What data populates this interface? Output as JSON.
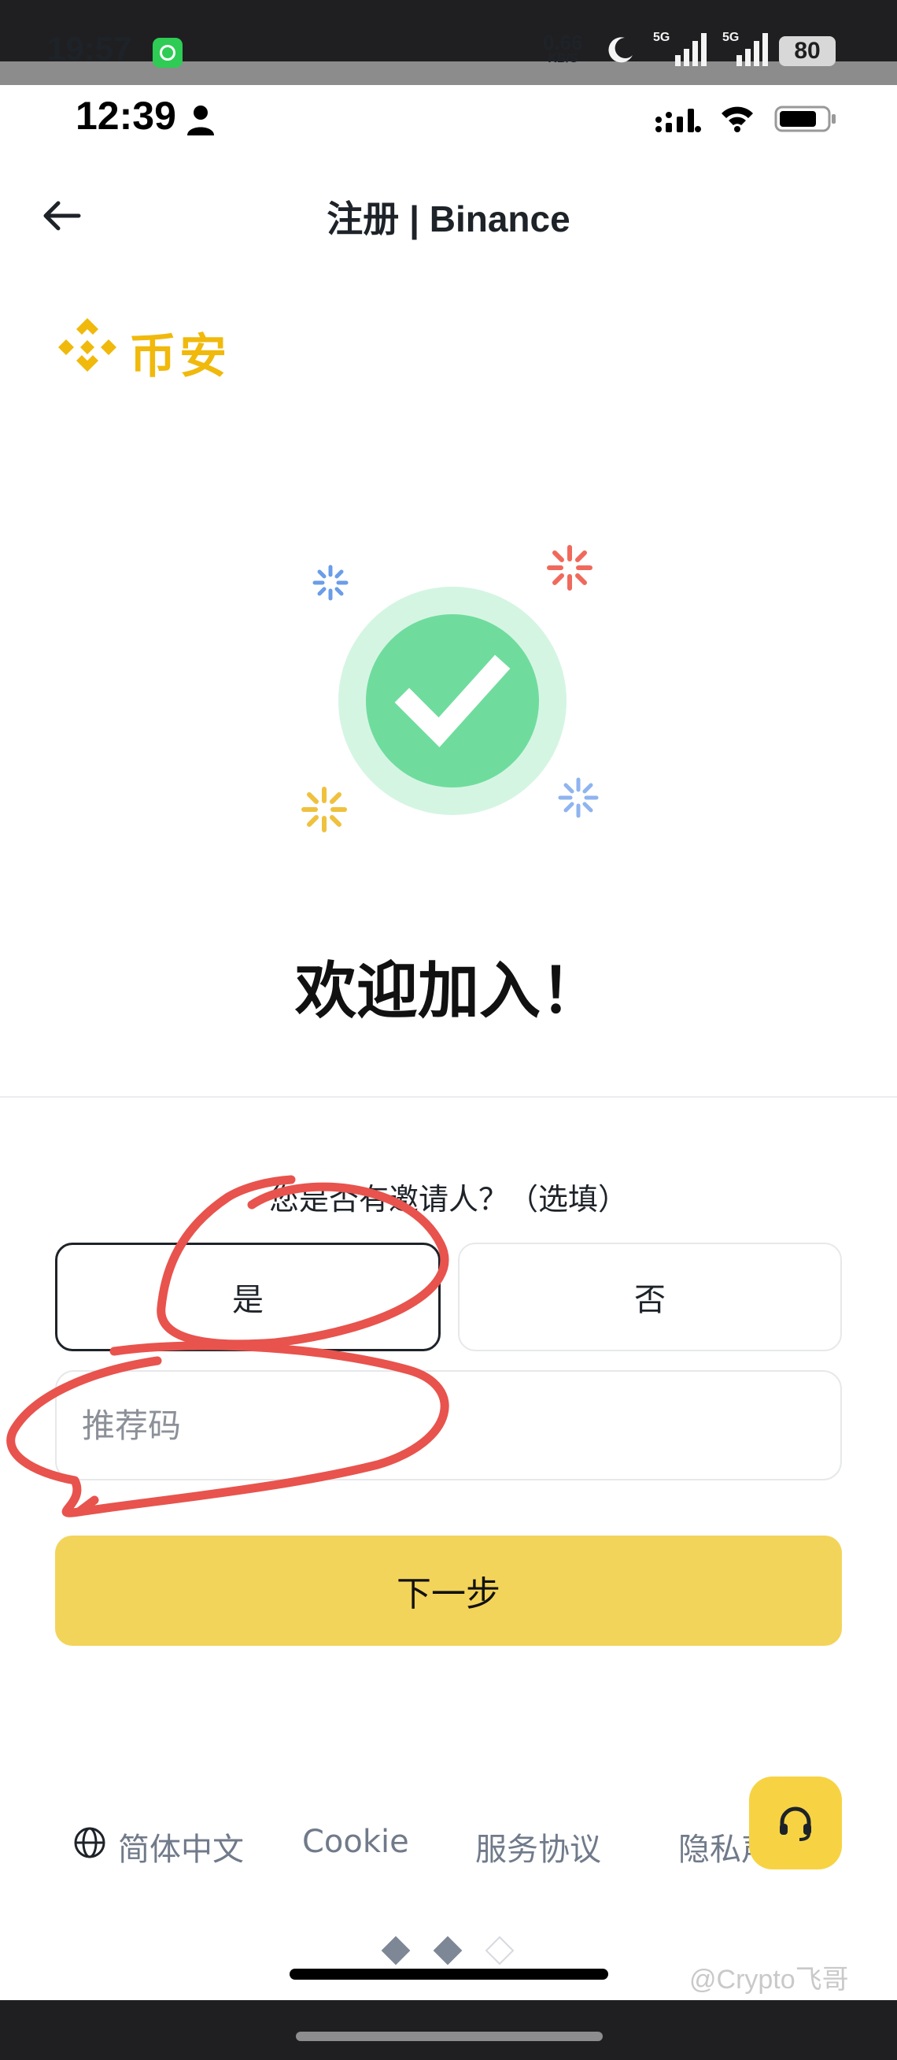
{
  "system_status_bar": {
    "time": "19:57",
    "net_speed_value": "0.66",
    "net_speed_unit": "KB/S",
    "network_label_1": "5G",
    "network_label_2": "5G",
    "battery": "80"
  },
  "app_status_bar": {
    "time": "12:39"
  },
  "header": {
    "title": "注册 | Binance"
  },
  "logo": {
    "text": "币安",
    "brand_color": "#f0b90b"
  },
  "welcome": {
    "heading": "欢迎加入！"
  },
  "referral": {
    "question": "您是否有邀请人？（选填）",
    "yes_label": "是",
    "no_label": "否",
    "selected": "是",
    "input_placeholder": "推荐码",
    "input_value": ""
  },
  "next_button": {
    "label": "下一步",
    "color": "#f3d45a"
  },
  "footer": {
    "language": "简体中文",
    "cookie": "Cookie",
    "terms": "服务协议",
    "privacy": "隐私声明"
  },
  "pagination": {
    "total": 3,
    "current": 3
  },
  "watermark": "@Crypto飞哥",
  "icons": {
    "back": "arrow-left-icon",
    "success": "check-circle-icon",
    "globe": "globe-icon",
    "support": "headset-icon"
  }
}
